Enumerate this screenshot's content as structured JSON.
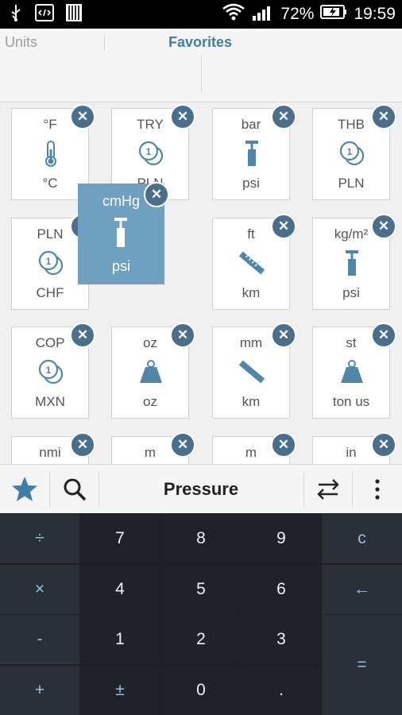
{
  "status": {
    "battery": "72%",
    "time": "19:59"
  },
  "tabs": {
    "units": "Units",
    "favorites": "Favorites"
  },
  "favorites": [
    {
      "from": "°F",
      "to": "°C",
      "icon": "thermometer-icon"
    },
    {
      "from": "TRY",
      "to": "PLN",
      "icon": "coins-icon"
    },
    {
      "from": "bar",
      "to": "psi",
      "icon": "pump-icon"
    },
    {
      "from": "THB",
      "to": "PLN",
      "icon": "coins-icon"
    },
    {
      "from": "PLN",
      "to": "CHF",
      "icon": "coins-icon"
    },
    {
      "from": "ft",
      "to": "km",
      "icon": "ruler-icon"
    },
    {
      "from": "kg/m²",
      "to": "psi",
      "icon": "pump-icon"
    },
    {
      "from": "COP",
      "to": "MXN",
      "icon": "coins-icon"
    },
    {
      "from": "oz",
      "to": "oz",
      "icon": "weight-icon"
    },
    {
      "from": "mm",
      "to": "km",
      "icon": "ruler-icon"
    },
    {
      "from": "st",
      "to": "ton us",
      "icon": "weight-icon"
    },
    {
      "from": "nmi",
      "to": "",
      "icon": ""
    },
    {
      "from": "m",
      "to": "",
      "icon": ""
    },
    {
      "from": "m",
      "to": "",
      "icon": ""
    },
    {
      "from": "in",
      "to": "",
      "icon": ""
    }
  ],
  "dragging": {
    "from": "cmHg",
    "to": "psi",
    "icon": "pump-icon"
  },
  "toolbar": {
    "category": "Pressure"
  },
  "keys": {
    "divide": "÷",
    "multiply": "×",
    "minus": "-",
    "plus": "+",
    "seven": "7",
    "eight": "8",
    "nine": "9",
    "four": "4",
    "five": "5",
    "six": "6",
    "one": "1",
    "two": "2",
    "three": "3",
    "plusminus": "±",
    "zero": "0",
    "dot": ".",
    "clear": "c",
    "backspace": "←",
    "equals": "="
  },
  "colors": {
    "accent": "#3f7ea8",
    "close": "#4a6f8c",
    "drag": "#6fa0c0",
    "keypad": "#1c1f24"
  }
}
